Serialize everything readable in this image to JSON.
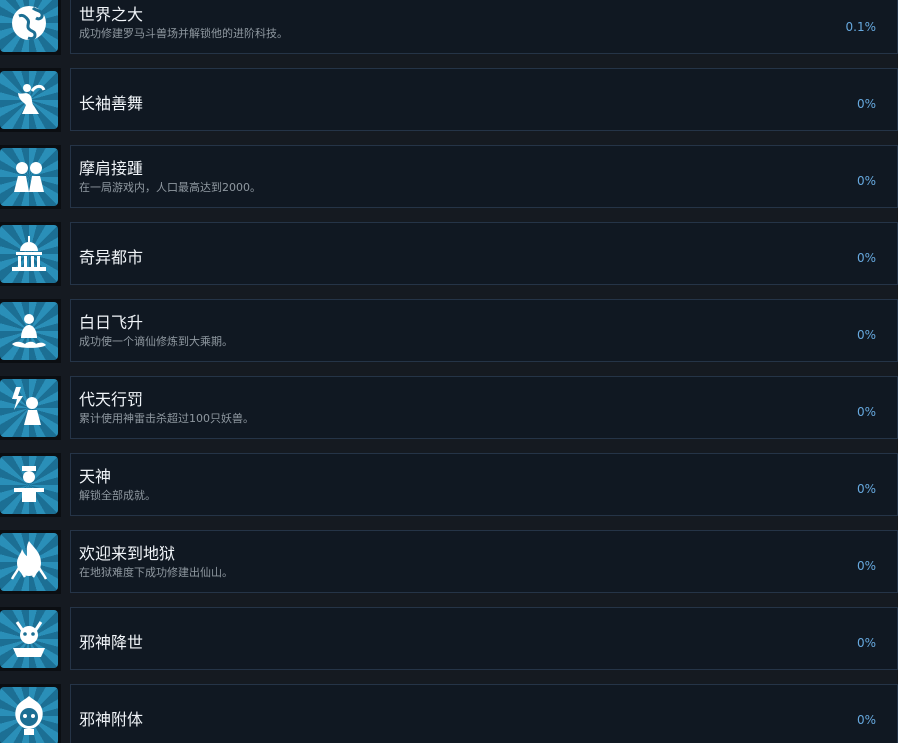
{
  "achievements": [
    {
      "title": "世界之大",
      "description": "成功修建罗马斗兽场并解锁他的进阶科技。",
      "percent": "0.1%",
      "icon": "globe-icon"
    },
    {
      "title": "长袖善舞",
      "description": "",
      "percent": "0%",
      "icon": "dancer-icon"
    },
    {
      "title": "摩肩接踵",
      "description": "在一局游戏内，人口最高达到2000。",
      "percent": "0%",
      "icon": "crowd-icon"
    },
    {
      "title": "奇异都市",
      "description": "",
      "percent": "0%",
      "icon": "palace-icon"
    },
    {
      "title": "白日飞升",
      "description": "成功使一个谪仙修炼到大乘期。",
      "percent": "0%",
      "icon": "ascending-immortal-icon"
    },
    {
      "title": "代天行罚",
      "description": "累计使用神雷击杀超过100只妖兽。",
      "percent": "0%",
      "icon": "lightning-icon"
    },
    {
      "title": "天神",
      "description": "解锁全部成就。",
      "percent": "0%",
      "icon": "deity-icon"
    },
    {
      "title": "欢迎来到地狱",
      "description": "在地狱难度下成功修建出仙山。",
      "percent": "0%",
      "icon": "flame-icon"
    },
    {
      "title": "邪神降世",
      "description": "",
      "percent": "0%",
      "icon": "demon-icon"
    },
    {
      "title": "邪神附体",
      "description": "",
      "percent": "0%",
      "icon": "possessed-icon"
    }
  ],
  "colors": {
    "background": "#151a21",
    "panel": "#101822",
    "border": "#253447",
    "percent": "#67a9df",
    "icon_light": "#2a8fb8",
    "icon_dark": "#1c6f94"
  }
}
